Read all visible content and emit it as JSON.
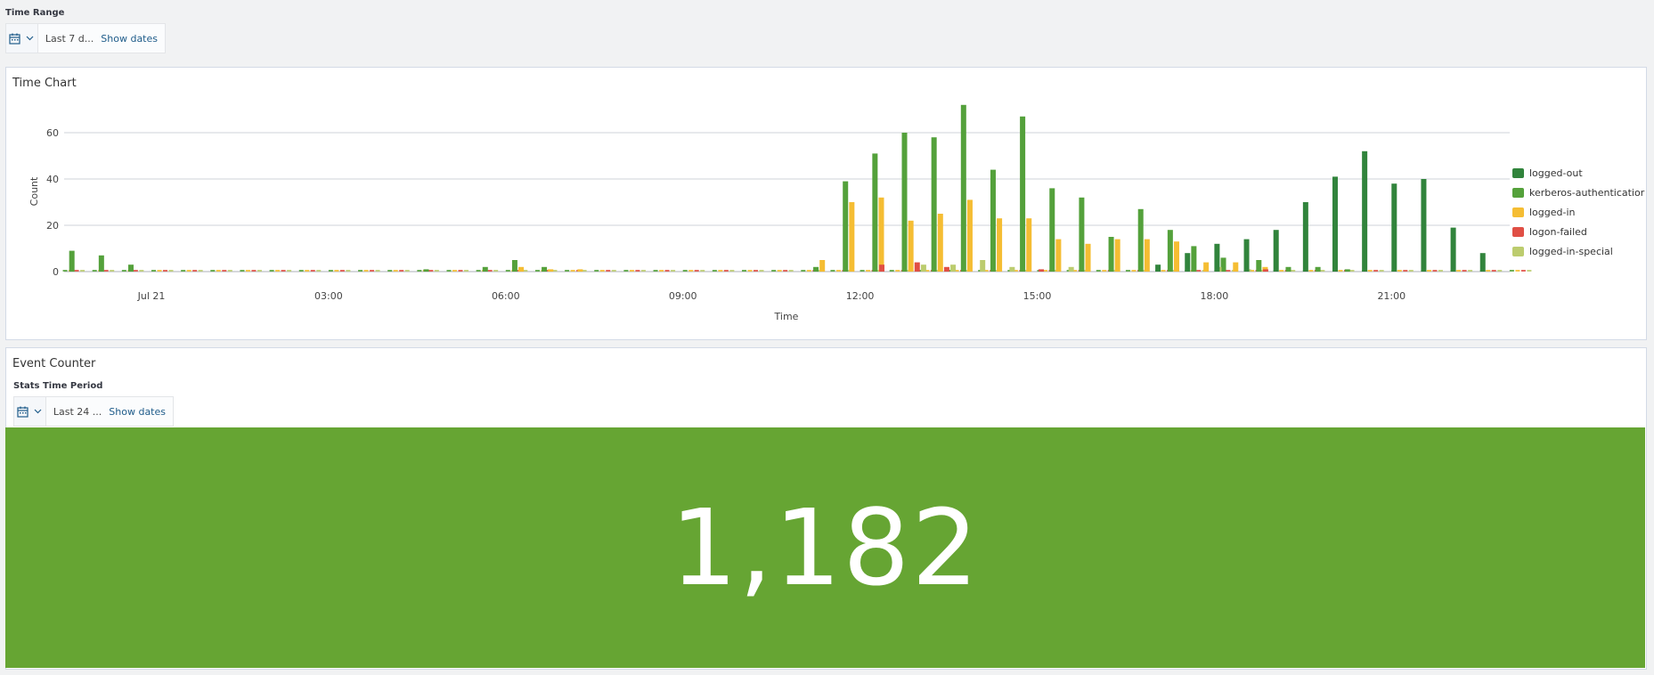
{
  "time_range": {
    "label": "Time Range",
    "range_text": "Last 7 d...",
    "show_dates": "Show dates"
  },
  "time_chart": {
    "title": "Time Chart"
  },
  "event_counter": {
    "title": "Event Counter",
    "stats_label": "Stats Time Period",
    "range_text": "Last 24 ...",
    "show_dates": "Show dates",
    "value": "1,182",
    "background": "#66a533"
  },
  "icons": [
    "calendar-icon",
    "chevron-down-icon"
  ],
  "chart_data": {
    "type": "bar",
    "xlabel": "Time",
    "ylabel": "Count",
    "ylim": [
      0,
      75
    ],
    "yticks": [
      0,
      20,
      40,
      60
    ],
    "xticks": [
      "Jul 21",
      "03:00",
      "06:00",
      "09:00",
      "12:00",
      "15:00",
      "18:00",
      "21:00"
    ],
    "x_unit": "hours since Jul 21 00:00",
    "xlim": [
      -1.5,
      23.2
    ],
    "bin_hours": 0.5,
    "grid": true,
    "legend_position": "right",
    "series": [
      {
        "name": "logged-out",
        "color": "#31843c",
        "values": []
      },
      {
        "name": "kerberos-authenticatior",
        "color": "#54a13b",
        "values": [
          [
            -1.4,
            9
          ],
          [
            -0.9,
            7
          ],
          [
            -0.4,
            3
          ],
          [
            4.6,
            1
          ],
          [
            5.6,
            2
          ],
          [
            6.1,
            5
          ],
          [
            6.6,
            2
          ],
          [
            11.2,
            2
          ],
          [
            11.7,
            39
          ],
          [
            12.2,
            51
          ],
          [
            12.7,
            60
          ],
          [
            13.2,
            58
          ],
          [
            13.7,
            72
          ],
          [
            14.2,
            44
          ],
          [
            14.7,
            67
          ],
          [
            15.2,
            36
          ],
          [
            15.7,
            32
          ],
          [
            16.2,
            15
          ],
          [
            16.7,
            27
          ],
          [
            17.2,
            18
          ],
          [
            17.6,
            11
          ],
          [
            18.1,
            6
          ],
          [
            18.7,
            5
          ],
          [
            19.2,
            2
          ],
          [
            19.7,
            2
          ],
          [
            20.2,
            1
          ]
        ]
      },
      {
        "name": "logged-in",
        "color": "#f5bd33",
        "values": [
          [
            6.2,
            2
          ],
          [
            6.7,
            1
          ],
          [
            7.2,
            1
          ],
          [
            11.3,
            5
          ],
          [
            11.8,
            30
          ],
          [
            12.3,
            32
          ],
          [
            12.8,
            22
          ],
          [
            13.3,
            25
          ],
          [
            13.8,
            31
          ],
          [
            14.3,
            23
          ],
          [
            14.8,
            23
          ],
          [
            15.3,
            14
          ],
          [
            15.8,
            12
          ],
          [
            16.3,
            14
          ],
          [
            16.8,
            14
          ],
          [
            17.3,
            13
          ],
          [
            17.8,
            4
          ],
          [
            18.3,
            4
          ],
          [
            18.8,
            2
          ]
        ]
      },
      {
        "name": "logon-failed",
        "color": "#e04f45",
        "values": [
          [
            12.3,
            3
          ],
          [
            12.9,
            4
          ],
          [
            13.4,
            2
          ],
          [
            15.0,
            1
          ],
          [
            18.8,
            1
          ]
        ]
      },
      {
        "name": "logged-in-special",
        "color": "#bccc6e",
        "values": [
          [
            13.0,
            3
          ],
          [
            13.5,
            3
          ],
          [
            14.0,
            5
          ],
          [
            14.5,
            2
          ],
          [
            15.5,
            2
          ],
          [
            18.0,
            2
          ],
          [
            18.5,
            1
          ]
        ]
      }
    ],
    "dark_bars": [
      [
        17.0,
        3
      ],
      [
        17.5,
        8
      ],
      [
        18.0,
        12
      ],
      [
        18.5,
        14
      ],
      [
        19.0,
        18
      ],
      [
        19.5,
        30
      ],
      [
        20.0,
        41
      ],
      [
        20.5,
        52
      ],
      [
        21.0,
        38
      ],
      [
        21.5,
        40
      ],
      [
        22.0,
        19
      ],
      [
        22.5,
        8
      ]
    ]
  }
}
